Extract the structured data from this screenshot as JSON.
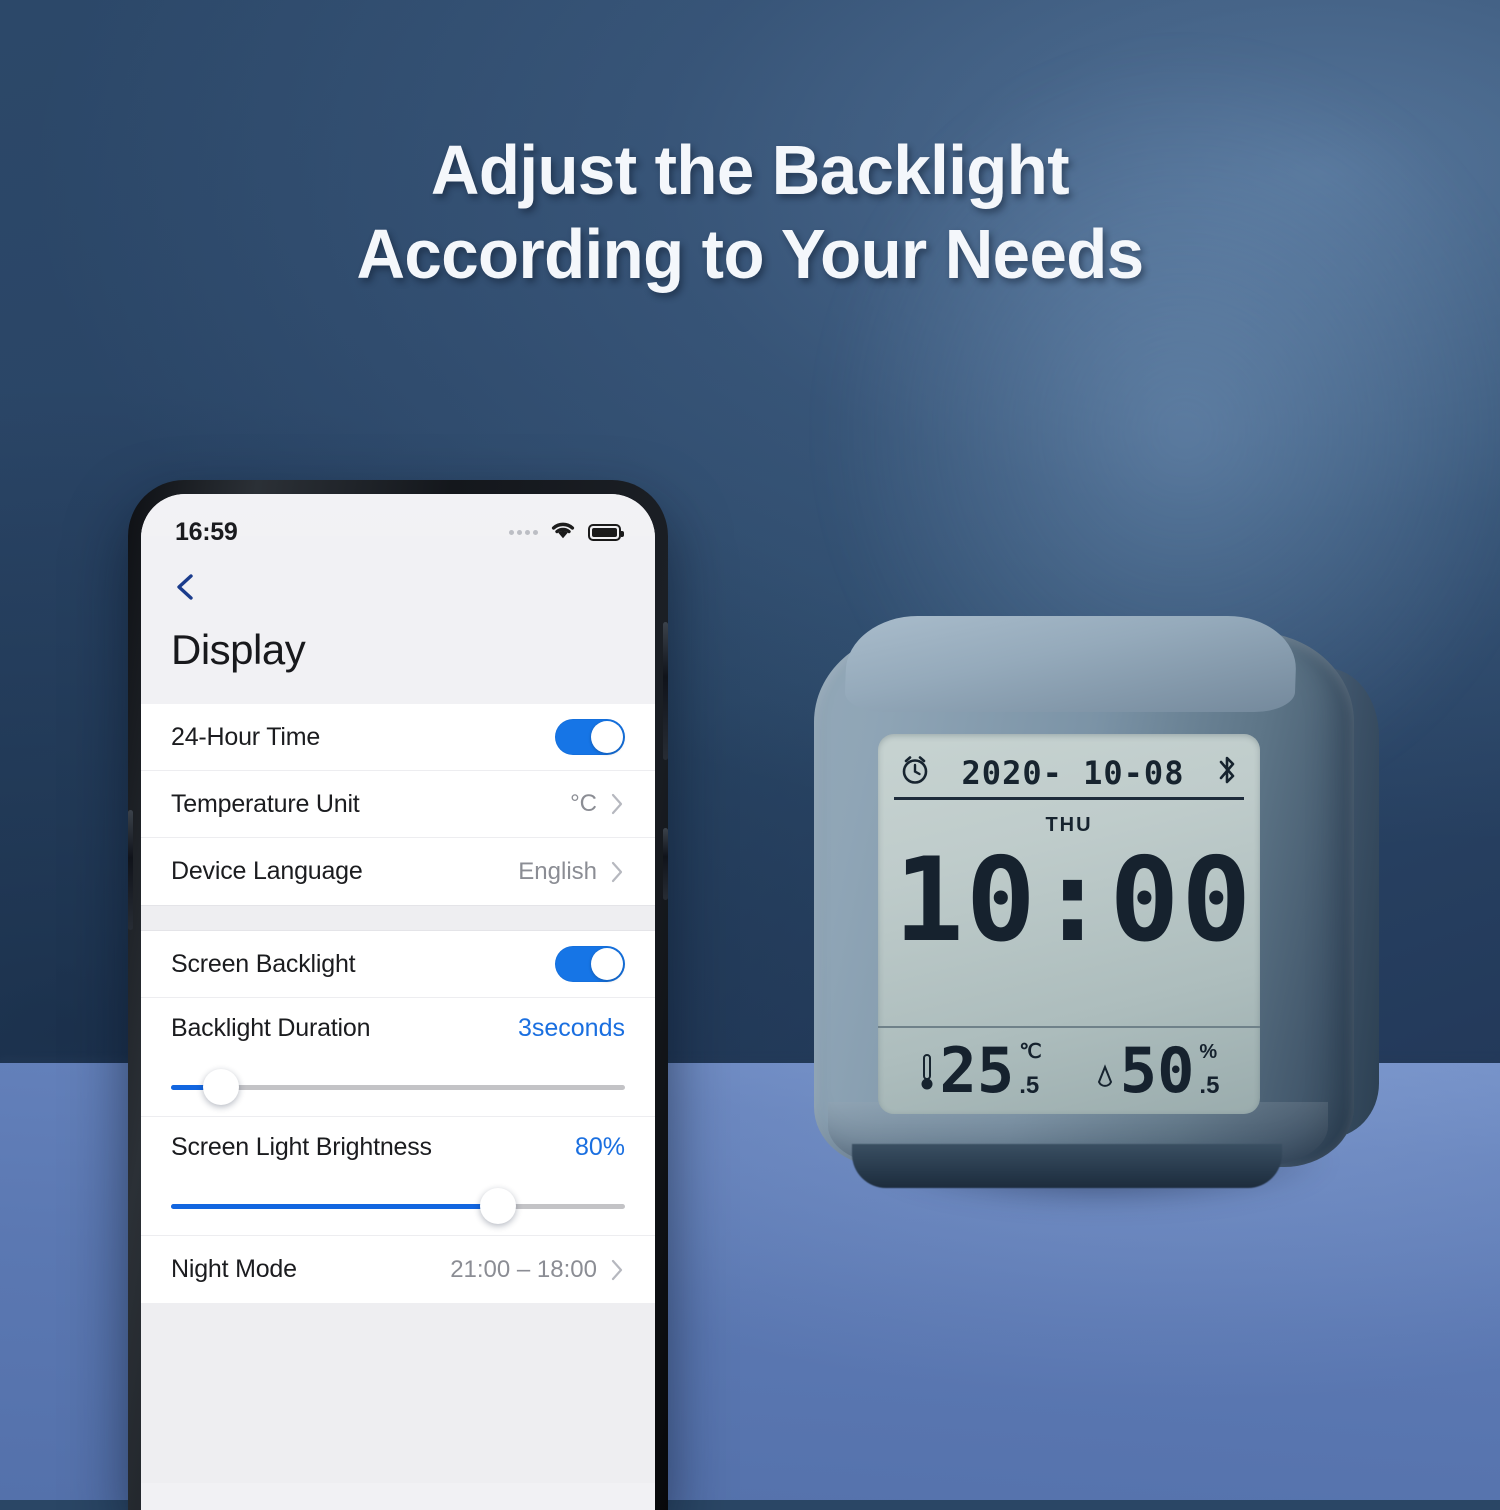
{
  "headline": {
    "line1": "Adjust the Backlight",
    "line2": "According to Your Needs"
  },
  "colors": {
    "accent_blue": "#1a6fe0",
    "toggle_on": "#1675e6",
    "wall": "#2a4665",
    "table": "#5b78b2",
    "lcd": "#bdcbc9"
  },
  "phone": {
    "status_bar": {
      "time": "16:59",
      "signal_icon": "signal-dots-icon",
      "wifi_icon": "wifi-icon",
      "battery_icon": "battery-full-icon"
    },
    "nav": {
      "back_icon": "back-chevron-icon"
    },
    "page_title": "Display",
    "section_one": [
      {
        "label": "24-Hour Time",
        "control": "toggle",
        "value": "on"
      },
      {
        "label": "Temperature Unit",
        "control": "disclosure",
        "value": "°C"
      },
      {
        "label": "Device Language",
        "control": "disclosure",
        "value": "English"
      }
    ],
    "section_two": {
      "backlight_toggle": {
        "label": "Screen Backlight",
        "control": "toggle",
        "value": "on"
      },
      "duration": {
        "label": "Backlight Duration",
        "value": "3seconds",
        "slider_percent": 11
      },
      "brightness": {
        "label": "Screen Light Brightness",
        "value": "80%",
        "slider_percent": 72
      },
      "night_mode": {
        "label": "Night Mode",
        "control": "disclosure",
        "value": "21:00 – 18:00"
      }
    }
  },
  "clock_device": {
    "lcd": {
      "alarm_icon": "alarm-clock-icon",
      "date": "2020- 10-08",
      "bluetooth_icon": "bluetooth-icon",
      "weekday": "THU",
      "time": "10:00",
      "temperature": {
        "icon": "thermometer-icon",
        "integer": "25",
        "decimal": ".5",
        "unit": "℃"
      },
      "humidity": {
        "icon": "water-drop-icon",
        "integer": "50",
        "decimal": ".5",
        "unit": "%"
      }
    }
  }
}
